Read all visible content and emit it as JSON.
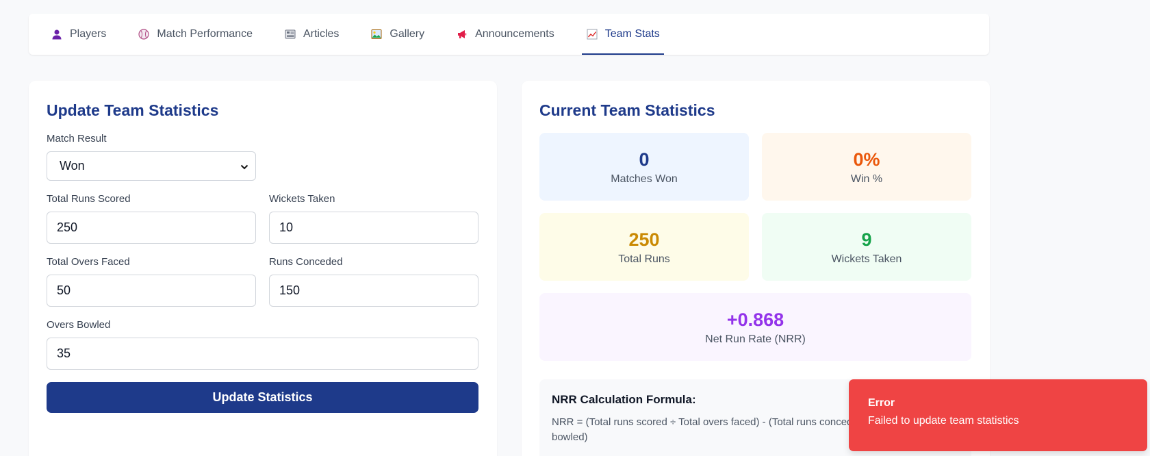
{
  "tabs": [
    {
      "label": "Players",
      "icon": "person-icon"
    },
    {
      "label": "Match Performance",
      "icon": "ball-icon"
    },
    {
      "label": "Articles",
      "icon": "newspaper-icon"
    },
    {
      "label": "Gallery",
      "icon": "picture-icon"
    },
    {
      "label": "Announcements",
      "icon": "megaphone-icon"
    },
    {
      "label": "Team Stats",
      "icon": "chart-icon",
      "active": true
    }
  ],
  "form": {
    "title": "Update Team Statistics",
    "match_result_label": "Match Result",
    "match_result_value": "Won",
    "total_runs_label": "Total Runs Scored",
    "total_runs_value": "250",
    "wickets_taken_label": "Wickets Taken",
    "wickets_taken_value": "10",
    "overs_faced_label": "Total Overs Faced",
    "overs_faced_value": "50",
    "runs_conceded_label": "Runs Conceded",
    "runs_conceded_value": "150",
    "overs_bowled_label": "Overs Bowled",
    "overs_bowled_value": "35",
    "submit_label": "Update Statistics"
  },
  "stats": {
    "title": "Current Team Statistics",
    "matches_won": {
      "value": "0",
      "caption": "Matches Won",
      "color": "#1e3a8a",
      "bg": "#eef5ff"
    },
    "win_pct": {
      "value": "0%",
      "caption": "Win %",
      "color": "#ea580c",
      "bg": "#fff7ed"
    },
    "total_runs": {
      "value": "250",
      "caption": "Total Runs",
      "color": "#ca8a04",
      "bg": "#fefce8"
    },
    "wickets": {
      "value": "9",
      "caption": "Wickets Taken",
      "color": "#16a34a",
      "bg": "#f0fdf4"
    },
    "nrr": {
      "value": "+0.868",
      "caption": "Net Run Rate (NRR)",
      "color": "#9333ea",
      "bg": "#faf5ff"
    },
    "formula_title": "NRR Calculation Formula:",
    "formula_text": "NRR = (Total runs scored ÷ Total overs faced) - (Total runs conceded ÷ Total overs bowled)"
  },
  "toast": {
    "title": "Error",
    "message": "Failed to update team statistics",
    "color": "#ef4444"
  }
}
